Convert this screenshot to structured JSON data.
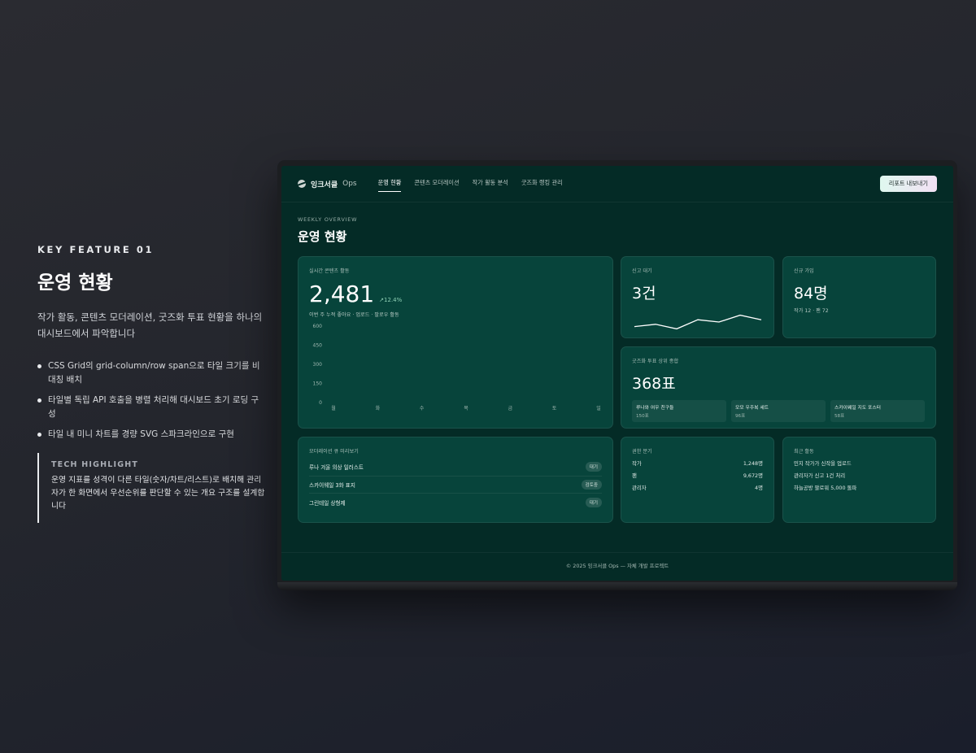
{
  "feature": {
    "kicker": "KEY FEATURE 01",
    "title": "운영 현황",
    "description": "작가 활동, 콘텐츠 모더레이션, 굿즈화 투표 현황을 하나의 대시보드에서 파악합니다",
    "bullets": [
      "CSS Grid의 grid-column/row span으로 타일 크기를 비대칭 배치",
      "타일별 독립 API 호출을 병렬 처리해 대시보드 초기 로딩 구성",
      "타일 내 미니 차트를 경량 SVG 스파크라인으로 구현"
    ],
    "tech_title": "TECH HIGHLIGHT",
    "tech_body": "운영 지표를 성격이 다른 타일(숫자/차트/리스트)로 배치해 관리자가 한 화면에서 우선순위를 판단할 수 있는 개요 구조를 설계합니다"
  },
  "app": {
    "logo_name": "잉크서클",
    "logo_suffix": "Ops",
    "nav": [
      "운영 현황",
      "콘텐츠 모더레이션",
      "작가 활동 분석",
      "굿즈화 랭킹 관리"
    ],
    "export_label": "리포트 내보내기",
    "kicker": "WEEKLY OVERVIEW",
    "page_title": "운영 현황",
    "footer": "© 2025 잉크서클 Ops — 자체 개발 프로젝트"
  },
  "activity": {
    "label": "실시간 콘텐츠 활동",
    "value": "2,481",
    "trend": "12.4%",
    "sub": "이번 주 누적 좋아요 · 업로드 · 팔로우 활동"
  },
  "report": {
    "label": "신고 대기",
    "value": "3건"
  },
  "signup": {
    "label": "신규 가입",
    "value": "84명",
    "sub": "작가 12 · 팬 72"
  },
  "vote": {
    "label": "굿즈화 투표 상위 종합",
    "value": "368표",
    "items": [
      {
        "name": "루나와 여우 친구들",
        "count": "150표"
      },
      {
        "name": "모모 우주복 세트",
        "count": "96표"
      },
      {
        "name": "스카이웨일 지도 포스터",
        "count": "58표"
      }
    ]
  },
  "queue": {
    "label": "모더레이션 큐 미리보기",
    "items": [
      {
        "title": "루나 겨울 의상 일러스트",
        "status": "대기"
      },
      {
        "title": "스카이웨일 3화 표지",
        "status": "검토중"
      },
      {
        "title": "그린테일 상형제",
        "status": "대기"
      }
    ]
  },
  "perm": {
    "label": "권한 분기",
    "rows": [
      {
        "name": "작가",
        "value": "1,248명"
      },
      {
        "name": "팬",
        "value": "9,672명"
      },
      {
        "name": "관리자",
        "value": "4명"
      }
    ]
  },
  "recent": {
    "label": "최근 활동",
    "items": [
      "민지 작가가 신작을 업로드",
      "관리자가 신고 1건 처리",
      "하늘공방 팔로워 5,000 돌파"
    ]
  },
  "icons": {
    "logo": "planet-icon",
    "trend": "trend-up-icon"
  },
  "chart_data": [
    {
      "type": "bar",
      "title": "",
      "categories": [
        "월",
        "화",
        "수",
        "목",
        "금",
        "토",
        "일"
      ],
      "values": [],
      "ylim": [
        0,
        600
      ],
      "yticks": [
        "600",
        "450",
        "300",
        "150",
        "0"
      ],
      "grid": false
    },
    {
      "type": "line",
      "title": "",
      "x": [
        1,
        2,
        3,
        4,
        5,
        6,
        7
      ],
      "values": [
        3,
        4,
        2,
        6,
        5,
        8,
        6
      ],
      "ylim": [
        0,
        10
      ],
      "grid": false
    }
  ]
}
